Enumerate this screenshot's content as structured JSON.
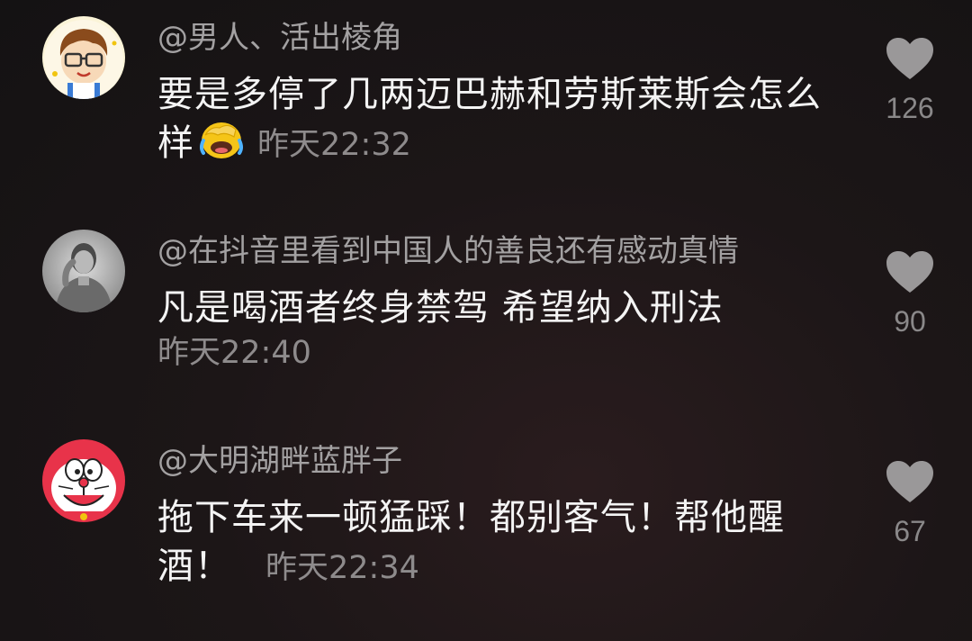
{
  "comments": [
    {
      "username": "@男人、活出棱角",
      "text": "要是多停了几两迈巴赫和劳斯莱斯会怎么样",
      "emoji_name": "facepalm-laugh-emoji",
      "time": "昨天22:32",
      "likes": "126",
      "avatar": "cartoon-boy-glasses-avatar"
    },
    {
      "username": "@在抖音里看到中国人的善良还有感动真情",
      "text": "凡是喝酒者终身禁驾 希望纳入刑法",
      "time": "昨天22:40",
      "likes": "90",
      "avatar": "bw-photo-man-avatar"
    },
    {
      "username": "@大明湖畔蓝胖子",
      "text": "拖下车来一顿猛踩！都别客气！帮他醒酒！",
      "time": "昨天22:34",
      "likes": "67",
      "avatar": "doraemon-avatar"
    }
  ],
  "colors": {
    "background": "#181415",
    "username": "#a3a1a2",
    "text": "#f4f4f4",
    "time": "#8e8b8c",
    "like_icon": "#9a9899"
  }
}
